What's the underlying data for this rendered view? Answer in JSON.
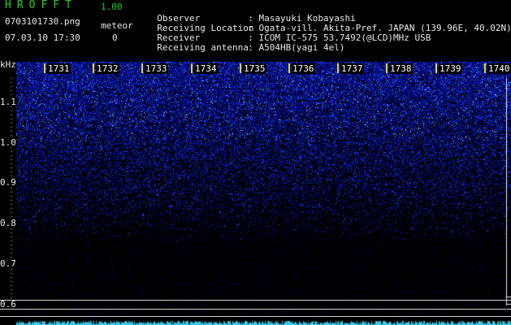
{
  "header": {
    "app_title": "HROFFT",
    "app_version": "1.00",
    "file_name": "0703101730.png",
    "mode_label": "meteor",
    "date_time": "07.03.10 17:30",
    "count": "0"
  },
  "info": [
    {
      "label": "Observer",
      "value": ": Masayuki Kobayashi"
    },
    {
      "label": "Receiving Location",
      "value": ": Ogata-vill. Akita-Pref. JAPAN (139.96E, 40.02N)"
    },
    {
      "label": "Receiver",
      "value": ": ICOM IC-575 53.7492(@LCD)MHz USB"
    },
    {
      "label": "Receiving antenna",
      "value": ": A504HB(yagi 4el)"
    }
  ],
  "axis": {
    "unit": "kHz",
    "y_labels": [
      "1.1",
      "1.0",
      "0.9",
      "0.8",
      "0.7",
      "0.6"
    ],
    "time_labels": [
      "1731",
      "1732",
      "1733",
      "1734",
      "1735",
      "1736",
      "1737",
      "1738",
      "1739",
      "1740"
    ]
  },
  "colors": {
    "title_green": "#1cd41c",
    "signal_blue": "#2b45ff",
    "tick_yellow": "#e8d32a",
    "baseline_cyan": "#36c9e6"
  }
}
